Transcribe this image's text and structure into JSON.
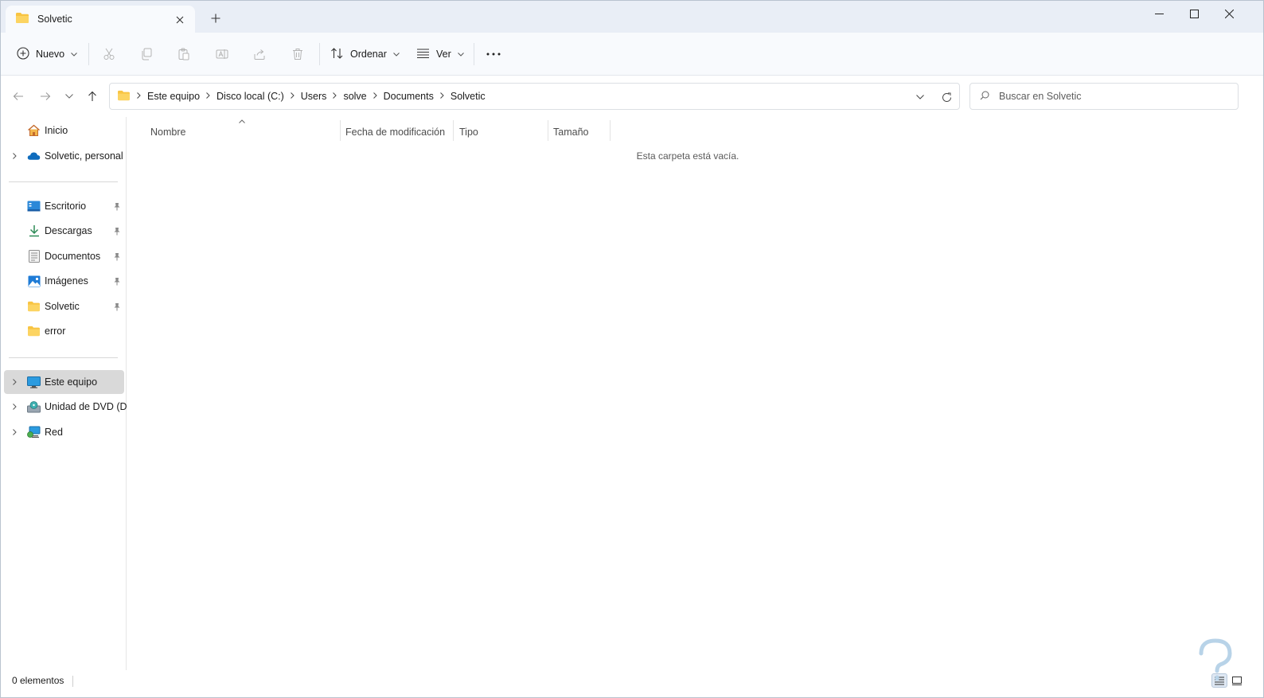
{
  "window": {
    "tab_title": "Solvetic",
    "tab_icon": "folder-icon",
    "new_tab_icon": "plus-icon",
    "controls": [
      "minimize-icon",
      "maximize-icon",
      "close-icon"
    ]
  },
  "toolbar": {
    "new_label": "Nuevo",
    "sort_label": "Ordenar",
    "view_label": "Ver",
    "more_label": "···",
    "disabled_actions": [
      "cut-icon",
      "copy-icon",
      "paste-icon",
      "rename-icon",
      "share-icon",
      "delete-icon"
    ]
  },
  "address": {
    "breadcrumbs": [
      "Este equipo",
      "Disco local (C:)",
      "Users",
      "solve",
      "Documents",
      "Solvetic"
    ]
  },
  "search": {
    "placeholder": "Buscar en Solvetic"
  },
  "sidebar": {
    "top": [
      {
        "label": "Inicio",
        "icon": "home-icon",
        "expandable": false
      },
      {
        "label": "Solvetic, personal",
        "icon": "cloud-icon",
        "expandable": true
      }
    ],
    "quick_access": [
      {
        "label": "Escritorio",
        "icon": "desktop-icon",
        "pinned": true
      },
      {
        "label": "Descargas",
        "icon": "download-icon",
        "pinned": true
      },
      {
        "label": "Documentos",
        "icon": "document-icon",
        "pinned": true
      },
      {
        "label": "Imágenes",
        "icon": "image-icon",
        "pinned": true
      },
      {
        "label": "Solvetic",
        "icon": "folder-icon",
        "pinned": true
      },
      {
        "label": "error",
        "icon": "folder-icon",
        "pinned": false
      }
    ],
    "devices": [
      {
        "label": "Este equipo",
        "icon": "computer-icon",
        "selected": true
      },
      {
        "label": "Unidad de DVD (D:)",
        "icon": "dvd-icon",
        "selected": false
      },
      {
        "label": "Red",
        "icon": "network-icon",
        "selected": false
      }
    ]
  },
  "columns": [
    "Nombre",
    "Fecha de modificación",
    "Tipo",
    "Tamaño"
  ],
  "content": {
    "empty_message": "Esta carpeta está vacía."
  },
  "status": {
    "items_count": "0 elementos"
  },
  "colors": {
    "folder": "#f8c442",
    "accent": "#0067c0",
    "selected_bg": "#d9d9d9",
    "title_bg": "#e9eef6"
  }
}
